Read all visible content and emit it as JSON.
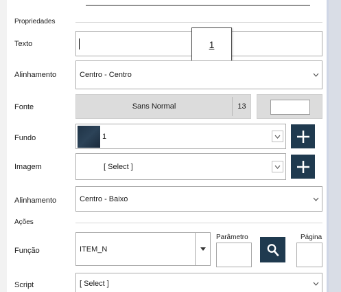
{
  "section_properties": "Propriedades",
  "section_actions": "Ações",
  "texto": {
    "label": "Texto",
    "value": ""
  },
  "popup": {
    "value": "1"
  },
  "alinhamento1": {
    "label": "Alinhamento",
    "value": "Centro - Centro"
  },
  "fonte": {
    "label": "Fonte",
    "name": "Sans Normal",
    "size": "13"
  },
  "fundo": {
    "label": "Fundo",
    "value": "1"
  },
  "imagem": {
    "label": "Imagem",
    "value": "[ Select ]"
  },
  "alinhamento2": {
    "label": "Alinhamento",
    "value": "Centro - Baixo"
  },
  "funcao": {
    "label": "Função",
    "value": "ITEM_N",
    "parametro_label": "Parâmetro",
    "pagina_label": "Página"
  },
  "script": {
    "label": "Script",
    "value": "[ Select ]"
  },
  "colors": {
    "accent": "#1f3a4f",
    "swatch": "#2c4358",
    "panel": "#dcdcdc"
  },
  "icons": {
    "add": "plus-icon",
    "search": "magnifier-icon",
    "dropdown": "chevron-down-icon"
  }
}
